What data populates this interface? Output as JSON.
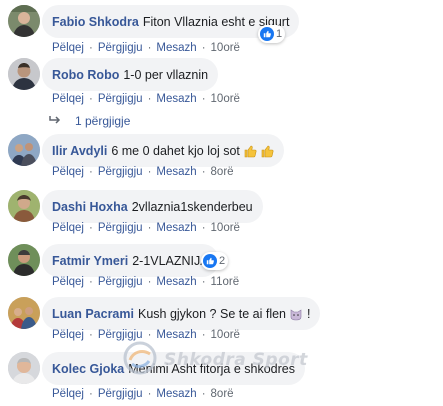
{
  "actions": {
    "like": "Pëlqej",
    "reply": "Përgjigju",
    "message": "Mesazh",
    "separator": "·"
  },
  "comments": [
    {
      "author": "Fabio Shkodra",
      "text": "Fiton Vllaznia esht e sigurt",
      "time": "10orë",
      "reactions": "1"
    },
    {
      "author": "Robo Robo",
      "text": "1-0 per vllaznin",
      "time": "10orë",
      "replies_link": "1 përgjigje"
    },
    {
      "author": "Ilir Avdyli",
      "text": "6 me 0 dahet kjo loj sot",
      "time": "8orë"
    },
    {
      "author": "Dashi Hoxha",
      "text": "2vllaznia1skenderbeu",
      "time": "10orë"
    },
    {
      "author": "Fatmir Ymeri",
      "text": "2-1VLAZNIJA",
      "time": "11orë",
      "reactions": "2"
    },
    {
      "author": "Luan Pacrami",
      "text": "Kush gjykon ? Se te ai flen",
      "text_end": "!",
      "time": "10orë"
    },
    {
      "author": "Kolec Gjoka",
      "text": "Menimi Asht fitorja e shkodres",
      "time": "8orë"
    }
  ],
  "watermark": {
    "text": "Shkodra Sport"
  },
  "colors": {
    "link": "#385898",
    "bubble": "#f2f3f5",
    "meta": "#606770",
    "like": "#1877f2"
  }
}
